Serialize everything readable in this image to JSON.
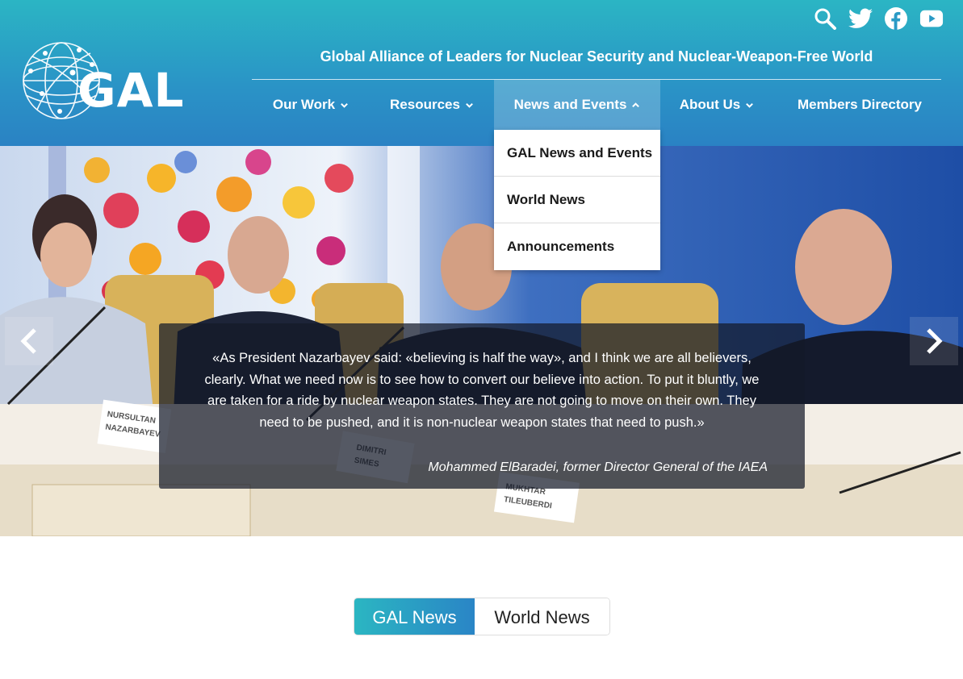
{
  "header": {
    "logo_text": "GAL",
    "tagline": "Global Alliance of Leaders for Nuclear Security and Nuclear-Weapon-Free World",
    "social_icons": [
      "search-icon",
      "twitter-icon",
      "facebook-icon",
      "youtube-icon"
    ]
  },
  "nav": {
    "items": [
      {
        "label": "Our Work",
        "has_dropdown": true
      },
      {
        "label": "Resources",
        "has_dropdown": true
      },
      {
        "label": "News and Events",
        "has_dropdown": true,
        "active": true
      },
      {
        "label": "About Us",
        "has_dropdown": true
      },
      {
        "label": "Members Directory",
        "has_dropdown": false
      }
    ],
    "dropdown": [
      "GAL News and Events",
      "World News",
      "Announcements"
    ]
  },
  "hero": {
    "quote": "«As President Nazarbayev said: «believing is half the way», and I think we are all believers, clearly. What we need now is to see how to convert our believe into action. To put it bluntly, we are taken for a ride by nuclear weapon states. They are not going to move on their own. They need to be pushed, and it is non-nuclear weapon states that need to push.»",
    "author": "Mohammed ElBaradei, former Director General of the IAEA",
    "placards": [
      "NURSULTAN NAZARBAYEV",
      "DIMITRI SIMES",
      "MUKHTAR TILEUBERDI"
    ]
  },
  "tabs": [
    {
      "label": "GAL News",
      "active": true
    },
    {
      "label": "World News",
      "active": false
    }
  ],
  "colors": {
    "header_top": "#2bb5c4",
    "header_bottom": "#2a82c4",
    "caption_bg": "#141928",
    "tab_active": "#2bb6c2"
  }
}
